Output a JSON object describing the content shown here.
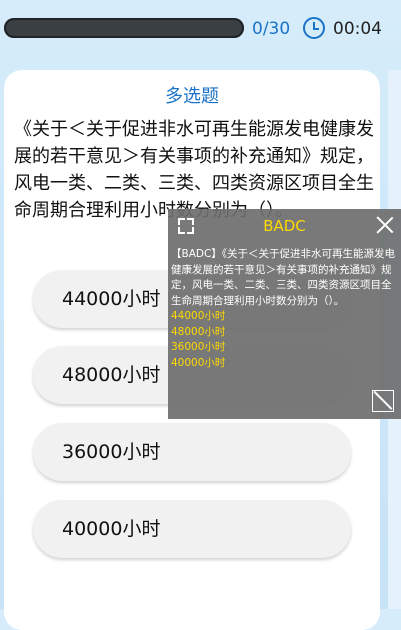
{
  "header": {
    "progress_text": "0/30",
    "progress_fraction": 0,
    "timer": "00:04"
  },
  "question": {
    "type": "多选题",
    "text": "《关于＜关于促进非水可再生能源发电健康发展的若干意见＞有关事项的补充通知》规定，风电一类、二类、三类、四类资源区项目全生命周期合理利用小时数分别为（）。",
    "options": [
      "44000小时",
      "48000小时",
      "36000小时",
      "40000小时"
    ]
  },
  "overlay": {
    "title": "BADC",
    "text": "【BADC】《关于＜关于促进非水可再生能源发电健康发展的若干意见＞有关事项的补充通知》规定，风电一类、二类、三类、四类资源区项目全生命周期合理利用小时数分别为（）。",
    "answers": [
      "44000小时",
      "48000小时",
      "36000小时",
      "40000小时"
    ]
  },
  "colors": {
    "accent": "#1a73c8",
    "highlight": "#ffd900"
  }
}
